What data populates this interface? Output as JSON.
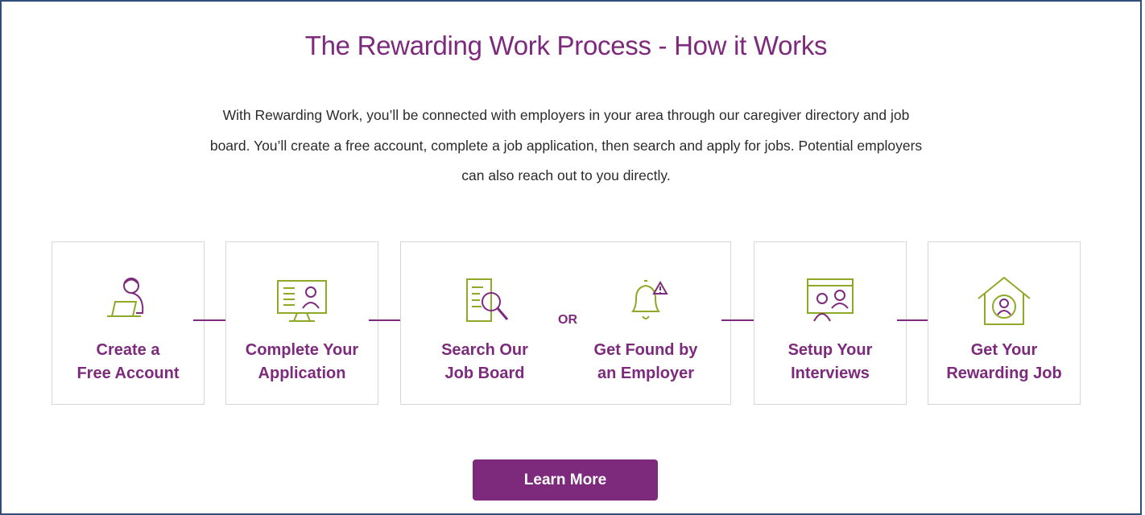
{
  "section": {
    "title": "The Rewarding Work Process - How it Works",
    "intro_lines": [
      "With Rewarding Work, you’ll be connected with employers in your area through our caregiver directory and job",
      "board. You’ll create a free account, complete a job application, then search and apply for jobs. Potential employers",
      "can also reach out to you directly."
    ]
  },
  "steps": [
    {
      "line1": "Create a",
      "line2": "Free Account",
      "icon": "person-laptop-icon"
    },
    {
      "line1": "Complete Your",
      "line2": "Application",
      "icon": "monitor-profile-icon"
    },
    {
      "line1": "Search Our",
      "line2": "Job Board",
      "icon": "document-search-icon"
    },
    {
      "line1": "Get Found by",
      "line2": "an Employer",
      "icon": "bell-alert-icon"
    },
    {
      "line1": "Setup Your",
      "line2": "Interviews",
      "icon": "video-call-icon"
    },
    {
      "line1": "Get Your",
      "line2": "Rewarding Job",
      "icon": "house-person-icon"
    }
  ],
  "or_label": "OR",
  "cta": {
    "label": "Learn More"
  },
  "colors": {
    "accent": "#7d2a7c",
    "icon_green": "#8ea827",
    "border": "#2f4e79"
  }
}
